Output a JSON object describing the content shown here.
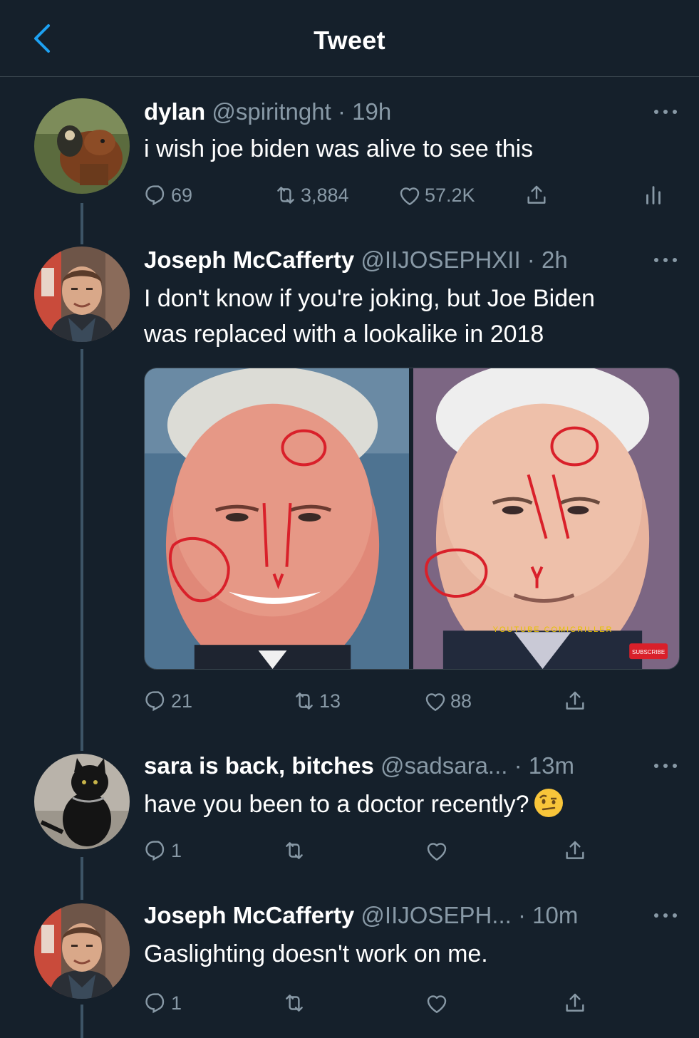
{
  "header": {
    "title": "Tweet"
  },
  "tweets": [
    {
      "name": "dylan",
      "handle": "@spiritnght",
      "time": "19h",
      "text": "i wish joe biden was alive to see this",
      "replies": "69",
      "retweets": "3,884",
      "likes": "57.2K"
    },
    {
      "name": "Joseph McCafferty",
      "handle": "@IIJOSEPHXII",
      "time": "2h",
      "text_line1": "I don't know if you're joking, but Joe Biden",
      "text_line2": "was replaced with a lookalike in 2018",
      "replies": "21",
      "retweets": "13",
      "likes": "88",
      "media_watermark": "YOUTUBE COMICRILLER",
      "media_badge": "SUBSCRIBE"
    },
    {
      "name": "sara is back, bitches",
      "handle": "@sadsara...",
      "time": "13m",
      "text": "have you been to a doctor recently?",
      "emoji": "face-with-raised-eyebrow",
      "replies": "1"
    },
    {
      "name": "Joseph McCafferty",
      "handle": "@IIJOSEPH...",
      "time": "10m",
      "text": "Gaslighting doesn't work on me.",
      "replies": "1"
    }
  ],
  "colors": {
    "background": "#15202b",
    "muted": "#8899a6",
    "accent": "#1da1f2",
    "divider": "#38444d",
    "thread_line": "#3d5466"
  },
  "icons": [
    "back-chevron-icon",
    "more-icon",
    "reply-icon",
    "retweet-icon",
    "like-icon",
    "share-icon",
    "analytics-icon"
  ]
}
